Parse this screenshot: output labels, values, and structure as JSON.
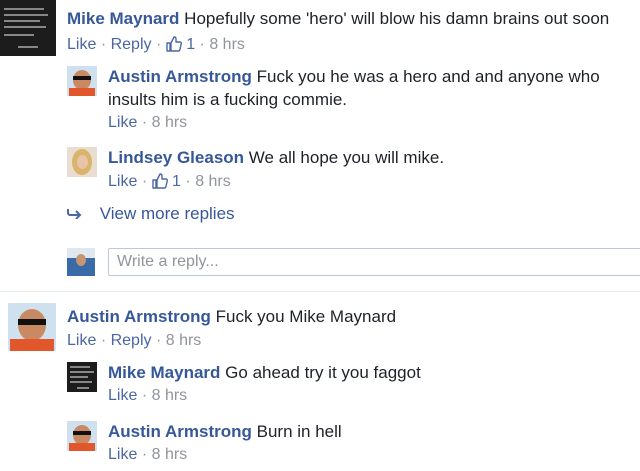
{
  "comments": [
    {
      "author": "Mike Maynard",
      "text": "Hopefully some 'hero' will blow his damn brains out soon",
      "actions": {
        "like": "Like",
        "reply": "Reply",
        "like_count": "1",
        "time": "8 hrs"
      },
      "replies": [
        {
          "author": "Austin Armstrong",
          "text_line1": "Fuck you he was a hero and and anyone who",
          "text_line2": "insults him is a fucking commie.",
          "actions": {
            "like": "Like",
            "time": "8 hrs"
          }
        },
        {
          "author": "Lindsey Gleason",
          "text": "We all hope you will mike.",
          "actions": {
            "like": "Like",
            "like_count": "1",
            "time": "8 hrs"
          }
        }
      ],
      "view_more": "View more replies",
      "reply_placeholder": "Write a reply..."
    },
    {
      "author": "Austin Armstrong",
      "text": "Fuck you Mike Maynard",
      "actions": {
        "like": "Like",
        "reply": "Reply",
        "time": "8 hrs"
      },
      "replies": [
        {
          "author": "Mike Maynard",
          "text": "Go ahead try it you faggot",
          "actions": {
            "like": "Like",
            "time": "8 hrs"
          }
        },
        {
          "author": "Austin Armstrong",
          "text": "Burn in hell",
          "actions": {
            "like": "Like",
            "time": "8 hrs"
          }
        }
      ]
    }
  ],
  "ui": {
    "separator": "·",
    "link_color": "#4b67a1",
    "name_color": "#365899",
    "meta_color": "#90949c",
    "icons": {
      "like": "thumbs-up-icon",
      "reply_arrow": "reply-arrow-icon"
    }
  }
}
